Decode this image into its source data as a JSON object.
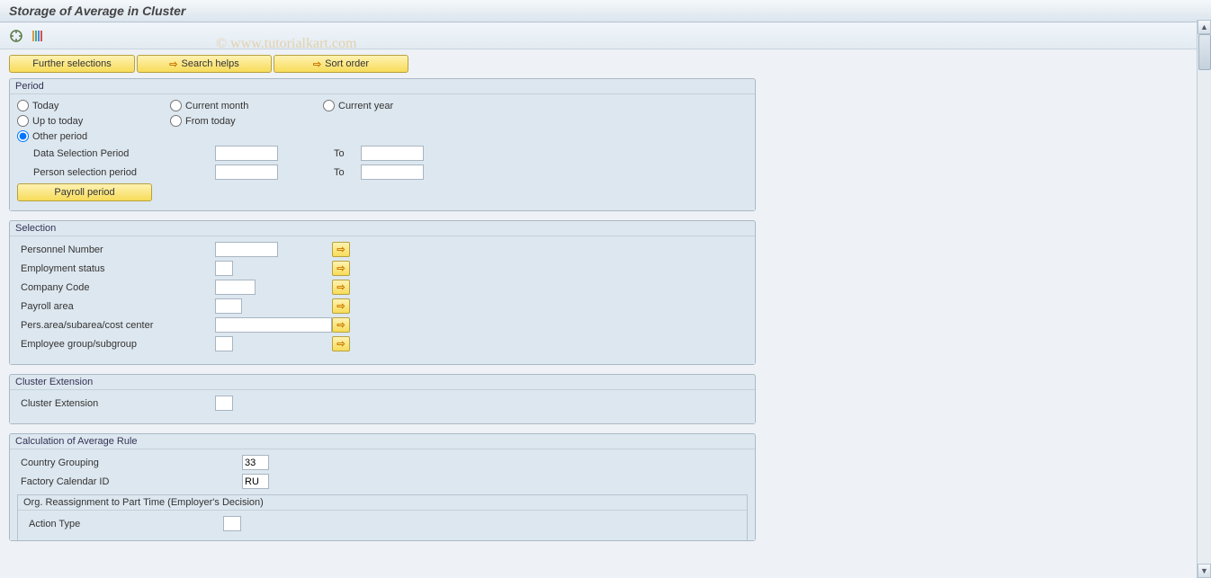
{
  "title": "Storage of Average in Cluster",
  "watermark": "© www.tutorialkart.com",
  "top_buttons": {
    "further_selections": "Further selections",
    "search_helps": "Search helps",
    "sort_order": "Sort order"
  },
  "groups": {
    "period": {
      "title": "Period",
      "radios": {
        "today": "Today",
        "current_month": "Current month",
        "current_year": "Current year",
        "up_to_today": "Up to today",
        "from_today": "From today",
        "other_period": "Other period"
      },
      "data_selection_period": "Data Selection Period",
      "person_selection_period": "Person selection period",
      "to": "To",
      "payroll_period": "Payroll period"
    },
    "selection": {
      "title": "Selection",
      "personnel_number": "Personnel Number",
      "employment_status": "Employment status",
      "company_code": "Company Code",
      "payroll_area": "Payroll area",
      "pers_area": "Pers.area/subarea/cost center",
      "employee_group": "Employee group/subgroup"
    },
    "cluster_extension": {
      "title": "Cluster Extension",
      "label": "Cluster Extension"
    },
    "calc_avg": {
      "title": "Calculation of Average Rule",
      "country_grouping": "Country Grouping",
      "country_grouping_value": "33",
      "factory_calendar": "Factory Calendar ID",
      "factory_calendar_value": "RU",
      "org_reassign": "Org. Reassignment to Part Time (Employer's Decision)",
      "action_type": "Action Type"
    }
  }
}
